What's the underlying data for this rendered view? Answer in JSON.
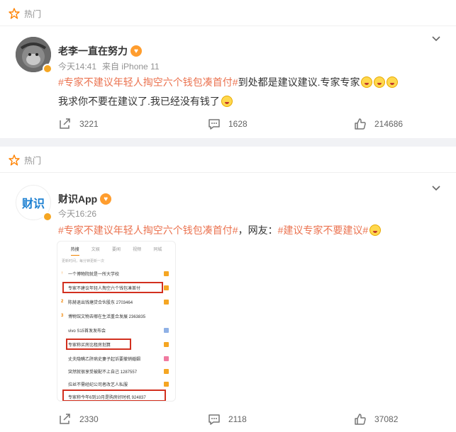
{
  "colors": {
    "accent": "#eb7350",
    "hot": "#ff8200",
    "highlight": "#d2301f"
  },
  "posts": [
    {
      "hot_label": "热门",
      "user": {
        "name": "老李一直在努力",
        "avatar_icon": "monkey-avatar-icon"
      },
      "meta": {
        "time": "今天14:41",
        "source": "来自 iPhone 11"
      },
      "line1": {
        "topic": "#专家不建议年轻人掏空六个钱包凑首付#",
        "text": "到处都是建议建议.专家专家"
      },
      "line2": "我求你不要在建议了.我已经没有钱了",
      "actions": {
        "repost": "3221",
        "comment": "1628",
        "like": "214686"
      }
    },
    {
      "hot_label": "热门",
      "user": {
        "name": "财识App",
        "avatar_text": "财识"
      },
      "meta": {
        "time": "今天16:26"
      },
      "line1": {
        "topic1": "#专家不建议年轻人掏空六个钱包凑首付#",
        "text": "，网友：",
        "topic2": "#建议专家不要建议#"
      },
      "embed": {
        "tabs": [
          "热搜",
          "文娱",
          "要闻",
          "视频",
          "同城"
        ],
        "subtitle": "更新时间，每分钟更新一次",
        "items": [
          {
            "rank": "↑",
            "text": "一个博物院就是一所大学校"
          },
          {
            "rank": "",
            "text": "专家不建议年轻人掏空六个钱包凑首付"
          },
          {
            "rank": "2",
            "text": "陈赫退出钱塘贷合伙股东 2703464"
          },
          {
            "rank": "3",
            "text": "博物馆文物去哪在生活重合发展 2363835"
          },
          {
            "rank": "",
            "text": "vivo S15首发发布会"
          },
          {
            "rank": "",
            "text": "专家称买房比租房划算"
          },
          {
            "rank": "",
            "text": "丈夫隐瞒乙肝病史妻子起诉要撤销婚姻"
          },
          {
            "rank": "",
            "text": "突然就很享受被配不上自己 1287557"
          },
          {
            "rank": "",
            "text": "拉丝不需经纪公司者改艺人私服"
          },
          {
            "rank": "",
            "text": "专家称今年6到10月是购房好时机 924837"
          }
        ]
      },
      "actions": {
        "repost": "2330",
        "comment": "2118",
        "like": "37082"
      }
    }
  ]
}
